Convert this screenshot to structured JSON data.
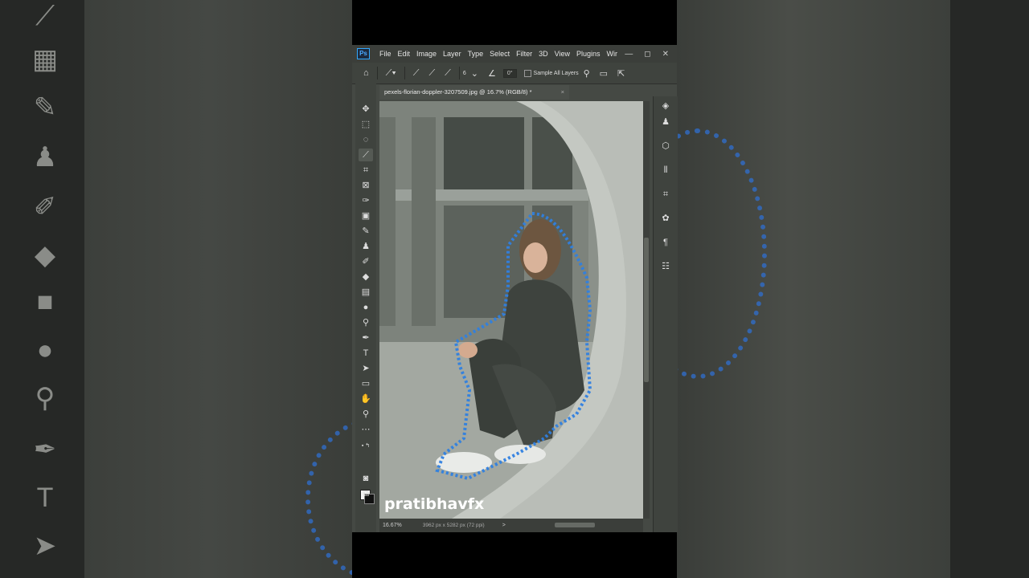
{
  "app": {
    "logo": "Ps",
    "menu": [
      "File",
      "Edit",
      "Image",
      "Layer",
      "Type",
      "Select",
      "Filter",
      "3D",
      "View",
      "Plugins",
      "Wir"
    ],
    "window_controls": [
      "—",
      "◻",
      "✕"
    ]
  },
  "options": {
    "angle": "0°",
    "sample_all_layers": "Sample All Layers",
    "brush_size": "6"
  },
  "document": {
    "tab_title": "pexels-florian-doppler-3207509.jpg @ 16.7% (RGB/8) *",
    "tab_close": "×"
  },
  "status": {
    "zoom": "16.67%",
    "dimensions": "3962 px x 5282 px (72 ppi)",
    "nav": ">"
  },
  "watermark": "pratibhavfx",
  "colors": {
    "accent": "#31a8ff",
    "selection": "#2f7fe0",
    "ui_bg": "#454944",
    "foreground_swatch": "#f4f4f4",
    "background_swatch": "#111111"
  },
  "icons": {
    "toolbar": [
      "move-icon",
      "marquee-icon",
      "lasso-icon",
      "quick-selection-icon",
      "crop-icon",
      "frame-icon",
      "eyedropper-icon",
      "healing-icon",
      "brush-icon",
      "stamp-icon",
      "history-brush-icon",
      "eraser-icon",
      "gradient-icon",
      "blur-icon",
      "dodge-icon",
      "pen-icon",
      "type-icon",
      "path-select-icon",
      "rectangle-icon",
      "hand-icon",
      "zoom-icon",
      "more-icon"
    ],
    "panel": [
      "layers-icon",
      "learn-icon",
      "3d-icon",
      "libraries-icon",
      "properties-icon",
      "color-icon",
      "paragraph-icon",
      "adjustments-icon"
    ]
  }
}
